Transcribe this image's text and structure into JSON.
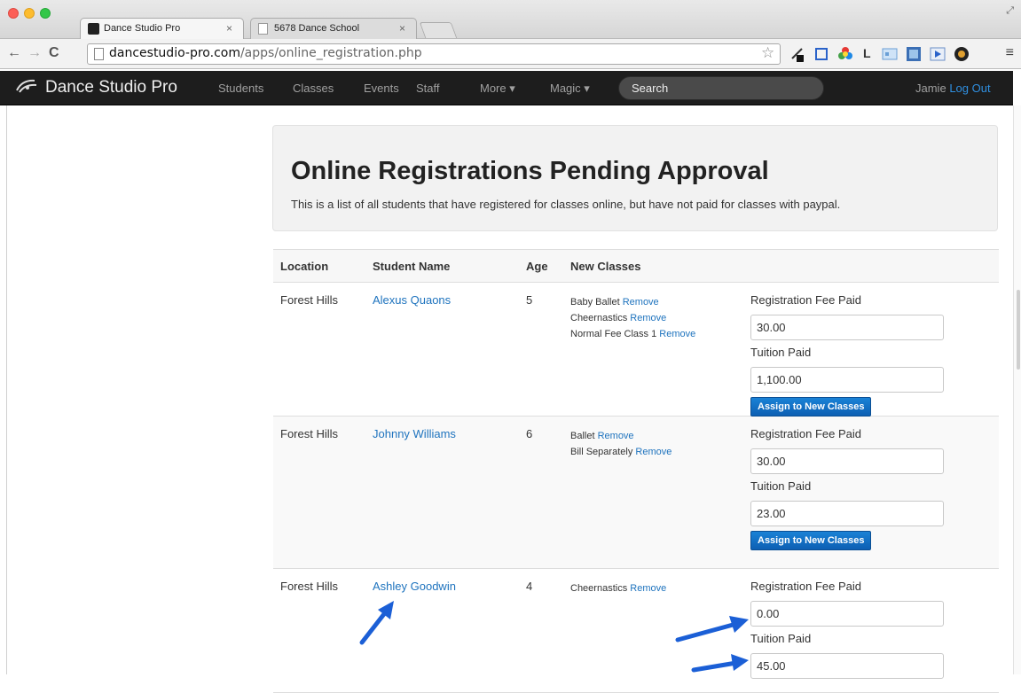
{
  "browser": {
    "tabs": [
      {
        "title": "Dance Studio Pro",
        "active": true
      },
      {
        "title": "5678 Dance School",
        "active": false
      }
    ],
    "url_host": "dancestudio-pro.com",
    "url_path": "/apps/online_registration.php",
    "extension_letter": "L"
  },
  "navbar": {
    "brand": "Dance Studio Pro",
    "links": [
      "Students",
      "Classes",
      "Events",
      "Staff",
      "More ▾",
      "Magic ▾"
    ],
    "search_placeholder": "Search",
    "user": "Jamie",
    "logout": "Log Out"
  },
  "hero": {
    "title": "Online Registrations Pending Approval",
    "description": "This is a list of all students that have registered for classes online, but have not paid for classes with paypal."
  },
  "table": {
    "headers": [
      "Location",
      "Student Name",
      "Age",
      "New Classes"
    ],
    "remove_label": "Remove",
    "reg_fee_label": "Registration Fee Paid",
    "tuition_label": "Tuition Paid",
    "assign_label": "Assign to New Classes",
    "rows": [
      {
        "location": "Forest Hills",
        "name": "Alexus Quaons",
        "age": "5",
        "classes": [
          "Baby Ballet",
          "Cheernastics",
          "Normal Fee Class 1"
        ],
        "reg_fee": "30.00",
        "tuition": "1,100.00"
      },
      {
        "location": "Forest Hills",
        "name": "Johnny Williams",
        "age": "6",
        "classes": [
          "Ballet",
          "Bill Separately"
        ],
        "reg_fee": "30.00",
        "tuition": "23.00"
      },
      {
        "location": "Forest Hills",
        "name": "Ashley Goodwin",
        "age": "4",
        "classes": [
          "Cheernastics"
        ],
        "reg_fee": "0.00",
        "tuition": "45.00"
      }
    ]
  },
  "colors": {
    "link": "#1e73be",
    "button": "#0d6ec4",
    "arrow": "#1b5fd6",
    "navbar": "#1d1d1d"
  }
}
